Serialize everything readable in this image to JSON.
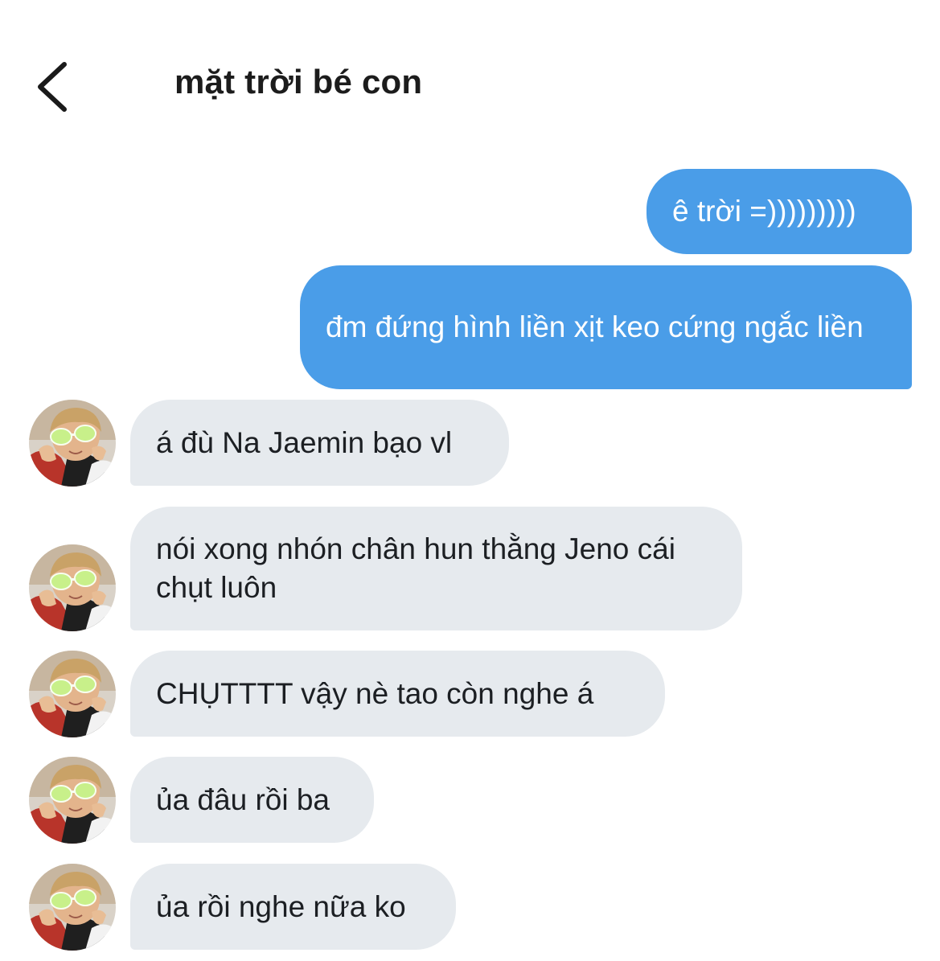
{
  "header": {
    "title": "mặt trời bé con",
    "back_icon": "chevron-left-icon"
  },
  "colors": {
    "outgoing_bubble": "#4a9de8",
    "incoming_bubble": "#e6eaee",
    "outgoing_text": "#ffffff",
    "incoming_text": "#1c1f23"
  },
  "messages": [
    {
      "direction": "outgoing",
      "text": "ê trời =)))))))))"
    },
    {
      "direction": "outgoing",
      "text": "đm đứng hình liền xịt keo cứng ngắc liền"
    },
    {
      "direction": "incoming",
      "text": "á đù Na Jaemin bạo vl"
    },
    {
      "direction": "incoming",
      "text": "nói xong nhón chân hun thằng Jeno cái chụt luôn"
    },
    {
      "direction": "incoming",
      "text": "CHỤTTTT vậy nè tao còn nghe á"
    },
    {
      "direction": "incoming",
      "text": "ủa đâu rồi ba"
    },
    {
      "direction": "incoming",
      "text": "ủa rồi nghe nữa ko"
    }
  ]
}
